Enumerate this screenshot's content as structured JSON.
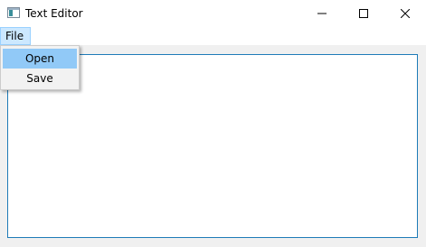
{
  "window": {
    "title": "Text Editor",
    "icon": "text-editor-app-icon",
    "controls": [
      "minimize",
      "maximize",
      "close"
    ]
  },
  "menubar": {
    "items": [
      {
        "label": "File",
        "state": "open"
      }
    ]
  },
  "file_menu": {
    "items": [
      {
        "label": "Open",
        "highlighted": true
      },
      {
        "label": "Save",
        "highlighted": false
      }
    ]
  },
  "editor": {
    "text": ""
  },
  "colors": {
    "accent_border": "#1e7bb8",
    "menu_active_bg": "#cce8ff",
    "menu_item_highlight": "#91c9f7"
  }
}
